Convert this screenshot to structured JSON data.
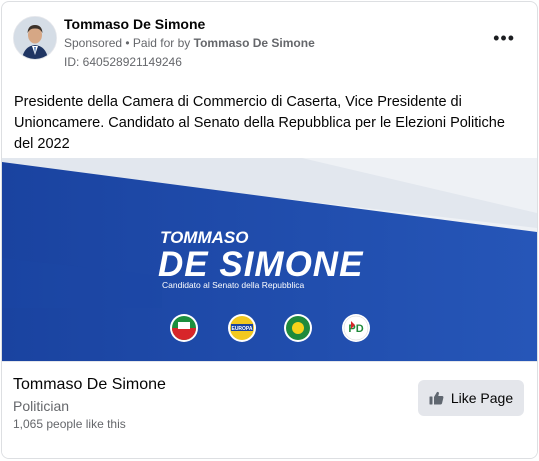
{
  "ad": {
    "advertiser": "Tommaso De Simone",
    "sponsored": "Sponsored",
    "separator": " • Paid for by ",
    "paid_for_by": "Tommaso De Simone",
    "id_text": "ID: 640528921149246",
    "more": "•••",
    "body": "Presidente della Camera di Commercio di Caserta, Vice Presidente di Unioncamere. Candidato al Senato della Repubblica per le Elezioni Politiche del 2022"
  },
  "banner": {
    "first_name": "TOMMASO",
    "last_name": "DE SIMONE",
    "subtitle": "Candidato al Senato della Repubblica",
    "logos": [
      {
        "text": "",
        "color": "#d7262a"
      },
      {
        "text": "EUROPA",
        "color": "#f2c81f"
      },
      {
        "text": "IMPEGNO CIVICO",
        "color": "#1e8a3c"
      },
      {
        "text": "PD",
        "color": "#ffffff"
      }
    ],
    "colors": {
      "blue": "#1f4aa8",
      "light": "#eef1f5"
    }
  },
  "footer": {
    "page_name": "Tommaso De Simone",
    "category": "Politician",
    "likes": "1,065 people like this",
    "like_button": "Like Page"
  }
}
